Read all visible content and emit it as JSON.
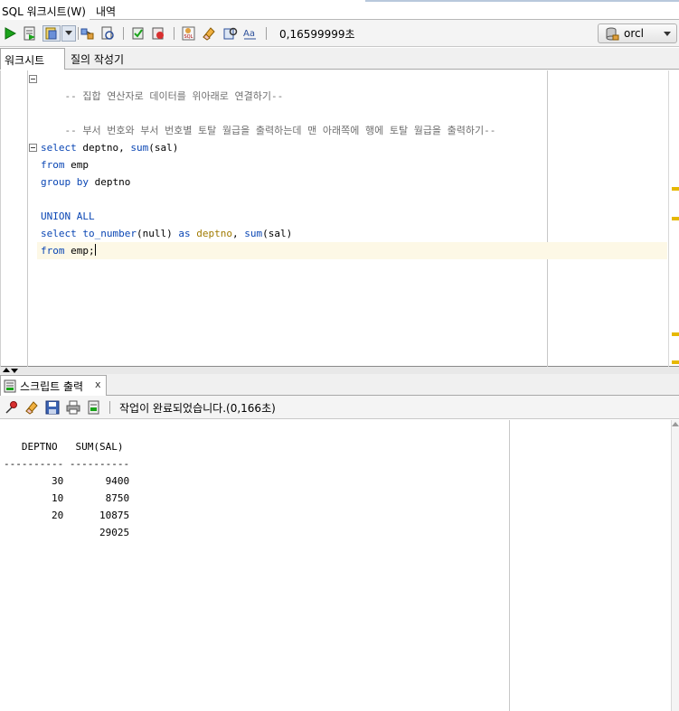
{
  "tabs": {
    "active": "SQL 워크시트(W)",
    "inactive": "내역"
  },
  "toolbar": {
    "elapsed": "0,16599999초",
    "connection": "orcl"
  },
  "editor_tabs": {
    "worksheet": "워크시트",
    "query_builder": "질의 작성기"
  },
  "editor": {
    "line1": "-- 집합 연산자로 데이터를 위아래로 연결하기--",
    "line2": "-- 부서 번호와 부서 번호별 토탈 월급을 출력하는데 맨 아래쪽에 행에 토탈 월급을 출력하기--",
    "q1_select": "select",
    "q1_cols": " deptno, ",
    "q1_fn": "sum",
    "q1_arg": "(sal)",
    "q1_from": "from",
    "q1_emp": " emp",
    "q1_group": "group by",
    "q1_group_col": " deptno",
    "union": "UNION ALL",
    "q2_select": "select",
    "q2_to_number": " to_number",
    "q2_null": "(null)",
    "q2_as": " as",
    "q2_deptno": " deptno",
    "q2_comma": ", ",
    "q2_fn": "sum",
    "q2_arg": "(sal)",
    "q2_from": "from",
    "q2_emp": " emp;"
  },
  "output": {
    "tab_label": "스크립트 출력",
    "close": "x",
    "status": "작업이 완료되었습니다.(0,166초)",
    "header": "   DEPTNO   SUM(SAL)",
    "divider": "---------- ----------",
    "rows": [
      "        30       9400",
      "        10       8750",
      "        20      10875",
      "                29025"
    ]
  },
  "icons": {
    "run": "play-icon",
    "run_script": "run-script-icon",
    "commit": "commit-icon",
    "rollback": "rollback-icon",
    "connection": "database-icon"
  },
  "colors": {
    "keyword": "#0a46b4",
    "comment": "#6f6f6f",
    "marker": "#e6b800",
    "current_line": "#fdf8e6"
  }
}
